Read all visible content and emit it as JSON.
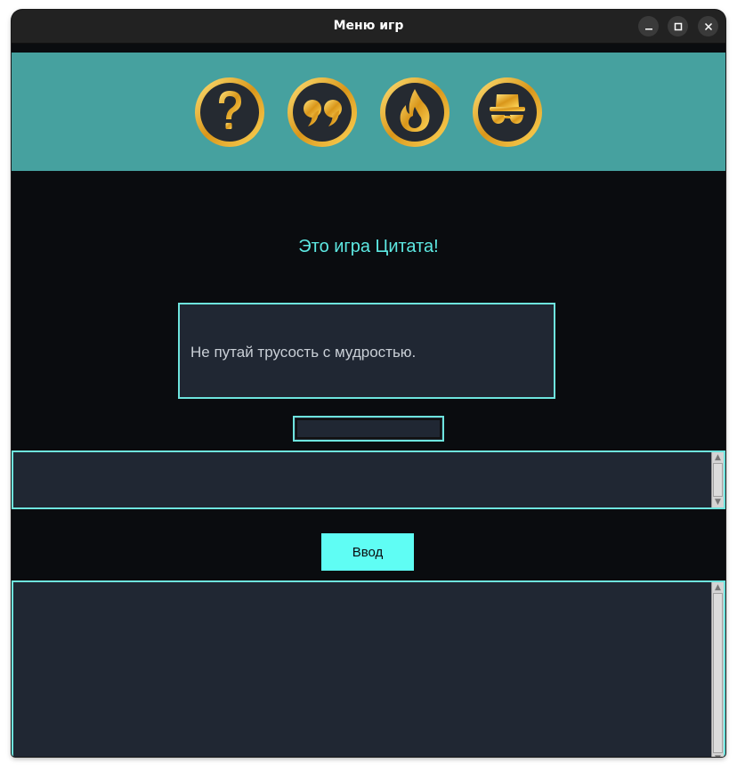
{
  "window": {
    "title": "Меню игр",
    "controls": {
      "minimize_icon": "minimize-icon",
      "maximize_icon": "maximize-icon",
      "close_icon": "close-icon"
    }
  },
  "game_menu": {
    "icons": [
      {
        "name": "question-mark-icon",
        "game": "mystery"
      },
      {
        "name": "quote-icon",
        "game": "quote"
      },
      {
        "name": "fire-icon",
        "game": "fire"
      },
      {
        "name": "incognito-icon",
        "game": "incognito"
      }
    ]
  },
  "main": {
    "heading": "Это игра Цитата!",
    "quote": "Не путай трусость с мудростью.",
    "small_input_value": "",
    "answer_value": "",
    "submit_label": "Ввод",
    "output_value": ""
  },
  "colors": {
    "accent": "#5de8e2",
    "toolbar_bg": "#46a19f",
    "panel_bg": "#202733",
    "window_bg": "#0a0c0f",
    "button_bg": "#5ffdf4",
    "icon_gold": "#e8b02a"
  }
}
